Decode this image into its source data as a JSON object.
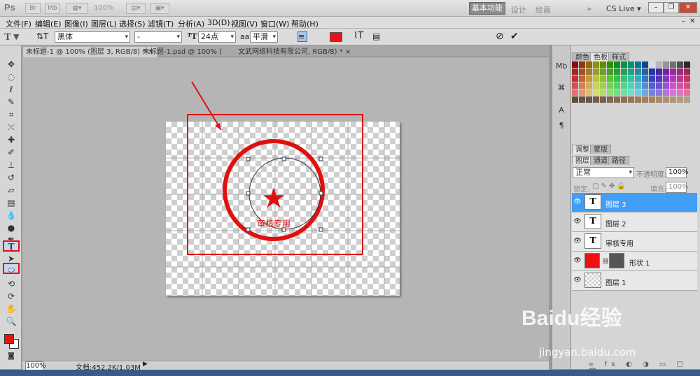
{
  "app": {
    "logo": "Ps",
    "zoom_label": "100%"
  },
  "workspaces": {
    "active": "基本功能",
    "items": [
      "设计",
      "绘画"
    ],
    "more": "»",
    "cs_live": "CS Live ▾"
  },
  "menu": [
    "文件(F)",
    "编辑(E)",
    "图像(I)",
    "图层(L)",
    "选择(S)",
    "滤镜(T)",
    "分析(A)",
    "3D(D)",
    "视图(V)",
    "窗口(W)",
    "帮助(H)"
  ],
  "options": {
    "font_family": "黑体",
    "font_style": "-",
    "font_size": "24点",
    "aa_label": "a",
    "antialias": "平滑",
    "text_color": "#ee1111"
  },
  "tabs": [
    {
      "label": "未标题-1 @ 100% (图层 3, RGB/8) * ×",
      "active": true
    },
    {
      "label": "未标题-1.psd @ 100% (",
      "active": false
    },
    {
      "label": "文武网络科技有限公司, RGB/8) * ×",
      "active": false
    }
  ],
  "canvas": {
    "stamp_text": "审核专用",
    "star": "★",
    "accent": "#e01010"
  },
  "status": {
    "zoom": "100%",
    "doc": "文档:452.2K/1.03M"
  },
  "panels": {
    "color_tabs": [
      "颜色",
      "色板",
      "样式"
    ],
    "adjust_tabs": [
      "调整",
      "蒙版"
    ],
    "layer_tabs": [
      "图层",
      "通道",
      "路径"
    ],
    "blend_mode": "正常",
    "opacity_label": "不透明度:",
    "opacity": "100%",
    "lock_label": "锁定:",
    "fill_label": "填充:",
    "fill": "100%"
  },
  "layers": [
    {
      "name": "图层 3",
      "thumb": "T",
      "selected": true
    },
    {
      "name": "图层 2",
      "thumb": "T",
      "selected": false
    },
    {
      "name": "审核专用",
      "thumb": "T",
      "selected": false
    },
    {
      "name": "形状 1",
      "thumb": "shape",
      "selected": false
    },
    {
      "name": "图层 1",
      "thumb": "empty",
      "selected": false
    }
  ],
  "watermark": {
    "brand": "Baidu经验",
    "url": "jingyan.baidu.com"
  }
}
